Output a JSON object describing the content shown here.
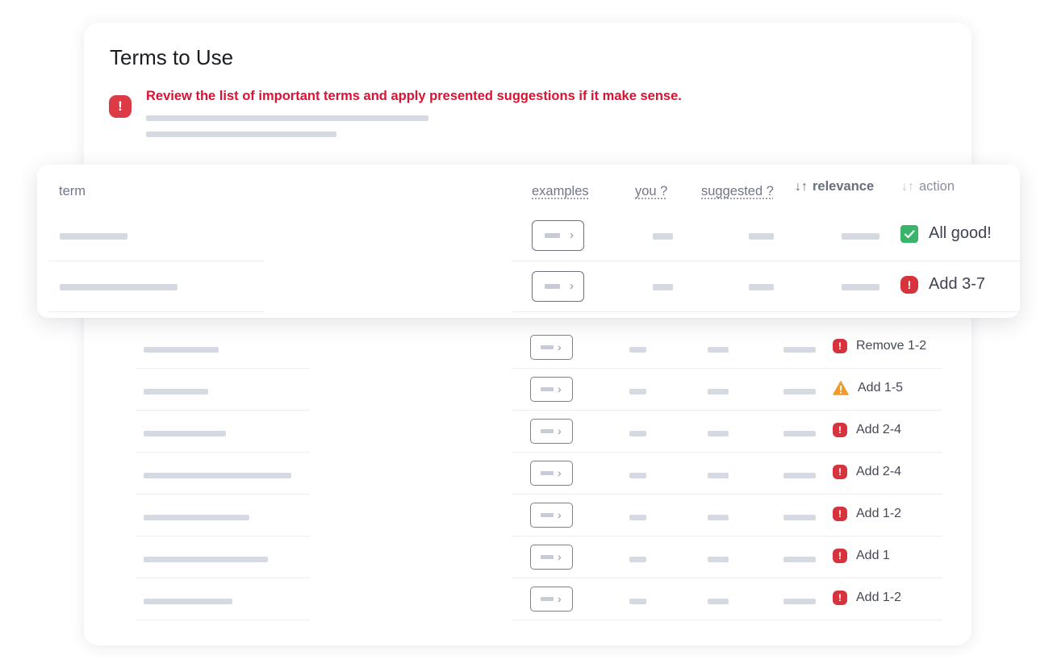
{
  "card": {
    "title": "Terms to Use",
    "warning": "Review the list of important terms and apply presented suggestions if it make sense.",
    "warning_icon": "exclamation-badge-icon"
  },
  "table": {
    "headers": {
      "term": "term",
      "examples": "examples",
      "you": "you ?",
      "suggested": "suggested ?",
      "relevance": "relevance",
      "action": "action"
    },
    "sort_icon": "↓↑"
  },
  "featured_rows": [
    {
      "action": "All good!",
      "status": "ok"
    },
    {
      "action": "Add 3-7",
      "status": "error"
    }
  ],
  "rows": [
    {
      "action": "Remove 1-2",
      "status": "error"
    },
    {
      "action": "Add 1-5",
      "status": "warning"
    },
    {
      "action": "Add 2-4",
      "status": "error"
    },
    {
      "action": "Add 2-4",
      "status": "error"
    },
    {
      "action": "Add 1-2",
      "status": "error"
    },
    {
      "action": "Add 1",
      "status": "error"
    },
    {
      "action": "Add 1-2",
      "status": "error"
    }
  ],
  "glyphs": {
    "exclaim": "!",
    "chevron": "›"
  },
  "colors": {
    "error": "#d6333c",
    "warning": "#f29a2e",
    "ok": "#3ab36b",
    "warning_text": "#dd1133"
  }
}
